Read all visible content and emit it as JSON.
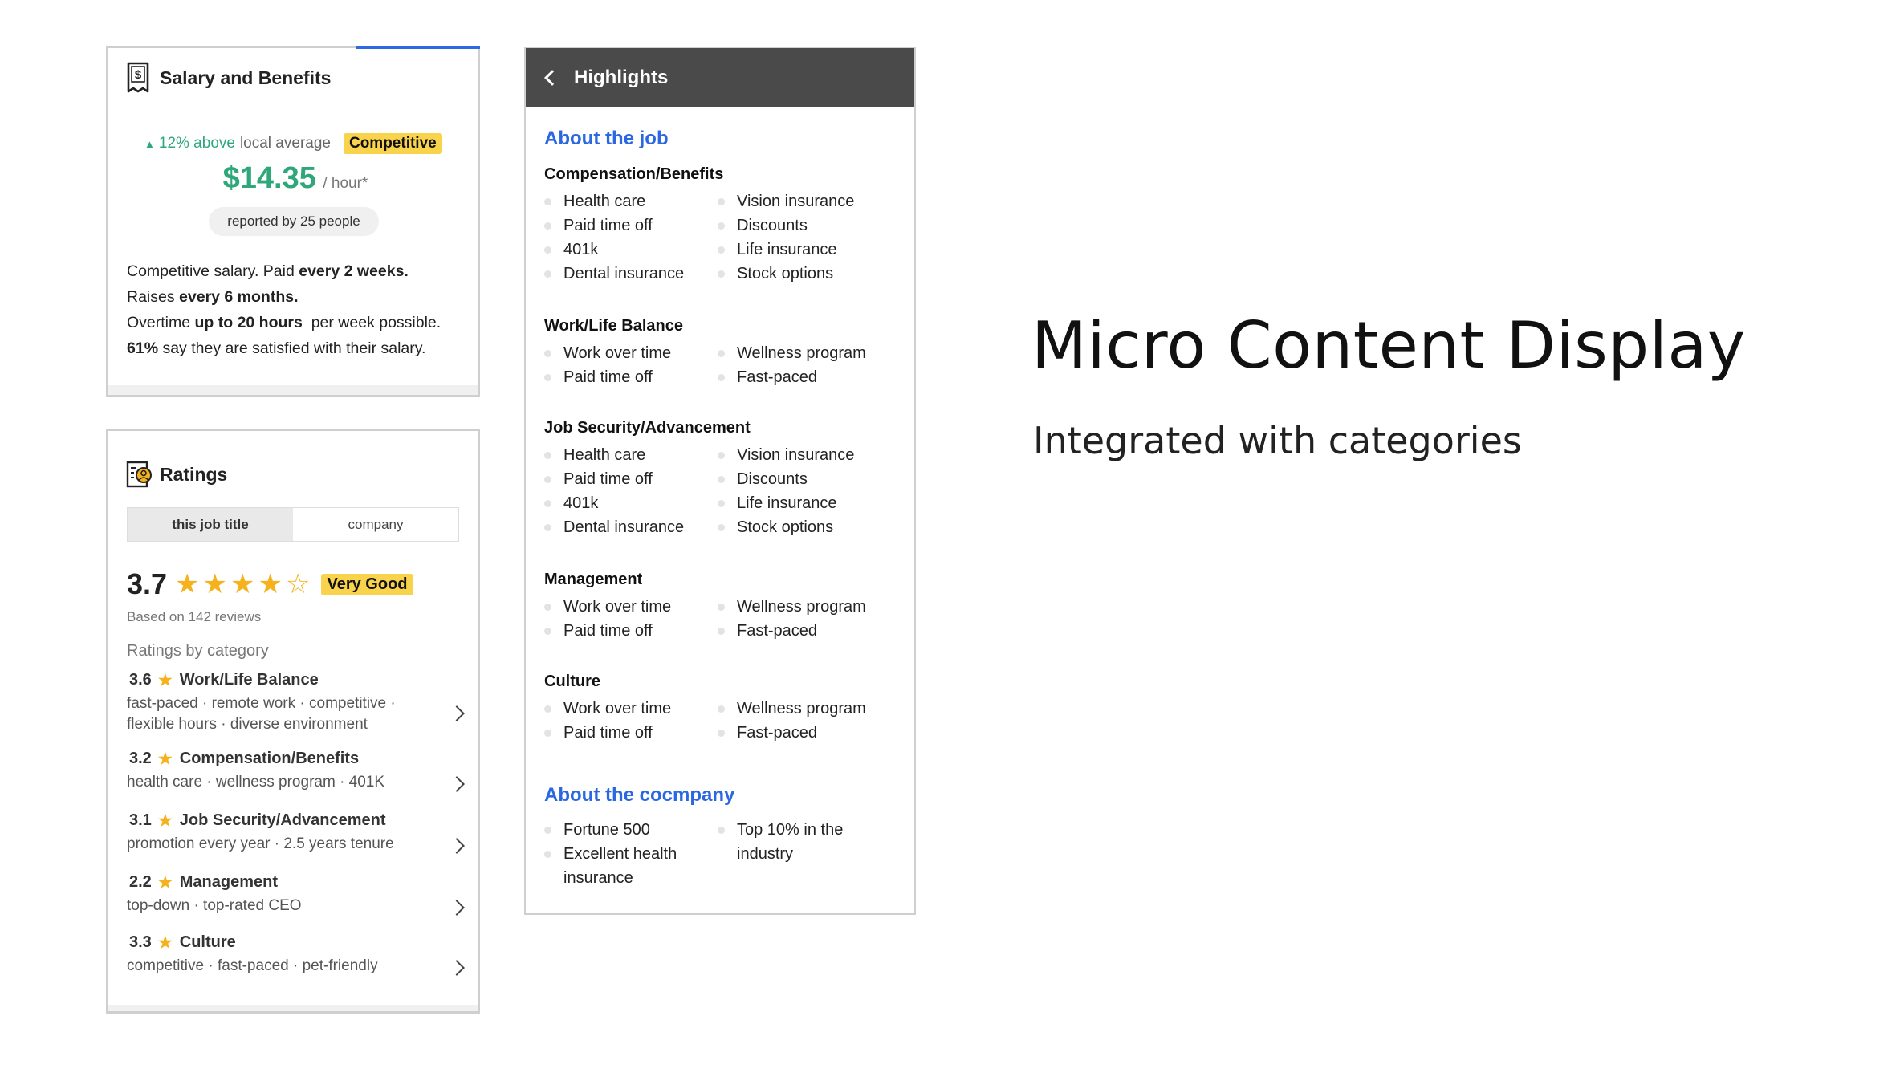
{
  "slide": {
    "title": "Micro Content Display",
    "subtitle": "Integrated with categories"
  },
  "salary": {
    "title": "Salary and Benefits",
    "icon": "salary-receipt-icon",
    "trend_icon": "up-triangle-icon",
    "above_pct": "12% above",
    "above_rest": "local average",
    "badge": "Competitive",
    "amount": "$14.35",
    "unit": "/ hour*",
    "reported": "reported by 25 people",
    "line1_a": "Competitive salary. Paid ",
    "line1_b": "every 2 weeks.",
    "line2_a": "Raises ",
    "line2_b": "every 6 months.",
    "line3_a": "Overtime ",
    "line3_b": "up to 20 hours",
    "line3_c": "  per week possible.",
    "line4_a": "61%",
    "line4_b": " say they are satisfied with their salary.",
    "colors": {
      "green": "#2ea77a",
      "badge": "#f9d34b",
      "accent": "#2d6ae3"
    }
  },
  "ratings": {
    "title": "Ratings",
    "icon": "ratings-person-icon",
    "tabs": [
      "this job title",
      "company"
    ],
    "score": "3.7",
    "star_rating": 3.7,
    "badge": "Very Good",
    "based_on": "Based on 142 reviews",
    "by_category": "Ratings by category",
    "categories": [
      {
        "score": "3.6",
        "name": "Work/Life Balance",
        "tags1": "fast-paced · remote work · competitive ·",
        "tags2": "flexible hours · diverse environment"
      },
      {
        "score": "3.2",
        "name": "Compensation/Benefits",
        "tags1": "health care · wellness program · 401K",
        "tags2": ""
      },
      {
        "score": "3.1",
        "name": "Job Security/Advancement",
        "tags1": "promotion every year · 2.5 years tenure",
        "tags2": ""
      },
      {
        "score": "2.2",
        "name": "Management",
        "tags1": "top-down · top-rated CEO",
        "tags2": ""
      },
      {
        "score": "3.3",
        "name": "Culture",
        "tags1": "competitive · fast-paced · pet-friendly",
        "tags2": ""
      }
    ]
  },
  "highlights": {
    "title": "Highlights",
    "about_job": "About the job",
    "groups": [
      {
        "title": "Compensation/Benefits",
        "items": [
          "Health care",
          "Vision insurance",
          "Paid time off",
          "Discounts",
          "401k",
          "Life insurance",
          "Dental insurance",
          "Stock options"
        ]
      },
      {
        "title": "Work/Life Balance",
        "items": [
          "Work over time",
          "Wellness program",
          "Paid time off",
          "Fast-paced"
        ]
      },
      {
        "title": "Job Security/Advancement",
        "items": [
          "Health care",
          "Vision insurance",
          "Paid time off",
          "Discounts",
          "401k",
          "Life insurance",
          "Dental insurance",
          "Stock options"
        ]
      },
      {
        "title": "Management",
        "items": [
          "Work over time",
          "Wellness program",
          "Paid time off",
          "Fast-paced"
        ]
      },
      {
        "title": "Culture",
        "items": [
          "Work over time",
          "Wellness program",
          "Paid time off",
          "Fast-paced"
        ]
      }
    ],
    "about_company": "About the cocmpany",
    "company_items": [
      "Fortune 500",
      "Top 10% in the industry",
      "Excellent health insurance",
      ""
    ]
  }
}
